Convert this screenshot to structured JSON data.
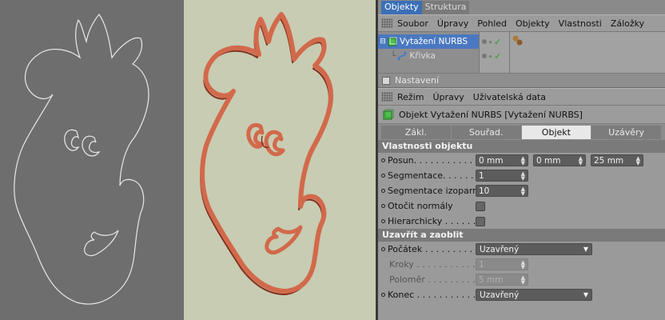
{
  "panel": {
    "tabs": [
      {
        "label": "Objekty",
        "active": true
      },
      {
        "label": "Struktura",
        "active": false
      }
    ],
    "menu": [
      "Soubor",
      "Úpravy",
      "Pohled",
      "Objekty",
      "Vlastnosti",
      "Záložky"
    ],
    "objects": [
      {
        "name": "Vytažení NURBS",
        "icon": "nurbs-extrude-icon",
        "selected": true
      },
      {
        "name": "Křivka",
        "icon": "spline-icon",
        "selected": false
      }
    ],
    "settings_label": "Nastavení",
    "attr_menu": [
      "Režim",
      "Úpravy",
      "Uživatelská data"
    ],
    "object_title": "Objekt Vytažení NURBS [Vytažení NURBS]",
    "attr_tabs": [
      {
        "label": "Zákl.",
        "active": false
      },
      {
        "label": "Souřad.",
        "active": false
      },
      {
        "label": "Objekt",
        "active": true
      },
      {
        "label": "Uzávěry",
        "active": false
      }
    ],
    "group1_title": "Vlastnosti objektu",
    "posun_label": "Posun. . . . . . . . . . . .",
    "posun_values": [
      "0 mm",
      "0 mm",
      "25 mm"
    ],
    "segmentace_label": "Segmentace. . . . . . .",
    "segmentace_value": "1",
    "segmentace_izoparm_label": "Segmentace izoparm",
    "segmentace_izoparm_value": "10",
    "otocit_label": "Otočit normály",
    "hierarchicky_label": "Hierarchicky . . . . . .",
    "group2_title": "Uzavřít a zaoblit",
    "pocatek_label": "Počátek . . . . . . . . . . .",
    "pocatek_value": "Uzavřený",
    "kroky_label": "Kroky . . . . . . . . . . .",
    "kroky_value": "1",
    "polomer_label": "Poloměr . . . . . . . . .",
    "polomer_value": "5 mm",
    "konec_label": "Konec . . . . . . . . . . .",
    "konec_value": "Uzavřený"
  },
  "colors": {
    "ribbon": "#d2694b",
    "ribbon_dark": "#7e3220",
    "viewport_left": "#6e6e6e",
    "viewport_mid": "#c8ccb2",
    "selection": "#4a78c0"
  }
}
